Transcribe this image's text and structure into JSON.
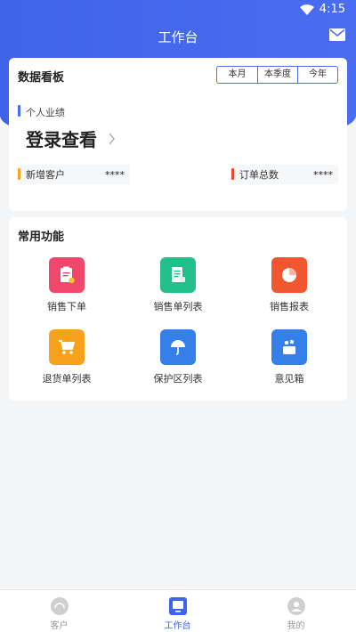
{
  "status_bar": {
    "time": "4:15"
  },
  "header": {
    "title": "工作台"
  },
  "dashboard": {
    "title": "数据看板",
    "periods": [
      "本月",
      "本季度",
      "今年"
    ],
    "section_label": "个人业绩",
    "login_text": "登录查看",
    "stats": [
      {
        "label": "新增客户",
        "value": "****"
      },
      {
        "label": "订单总数",
        "value": "****"
      }
    ]
  },
  "functions": {
    "title": "常用功能",
    "items": [
      {
        "label": "销售下单",
        "icon": "order-clipboard-icon",
        "color": "#f0476c"
      },
      {
        "label": "销售单列表",
        "icon": "document-list-icon",
        "color": "#22bf8a"
      },
      {
        "label": "销售报表",
        "icon": "pie-chart-icon",
        "color": "#f0562f"
      },
      {
        "label": "退货单列表",
        "icon": "shopping-cart-icon",
        "color": "#f7a21b"
      },
      {
        "label": "保护区列表",
        "icon": "umbrella-icon",
        "color": "#3480e8"
      },
      {
        "label": "意见箱",
        "icon": "feedback-box-icon",
        "color": "#3480e8"
      }
    ]
  },
  "tabbar": {
    "tabs": [
      {
        "label": "客户",
        "active": false
      },
      {
        "label": "工作台",
        "active": true
      },
      {
        "label": "我的",
        "active": false
      }
    ],
    "active_color": "#3f63ea",
    "inactive_color": "#9a9a9a"
  }
}
